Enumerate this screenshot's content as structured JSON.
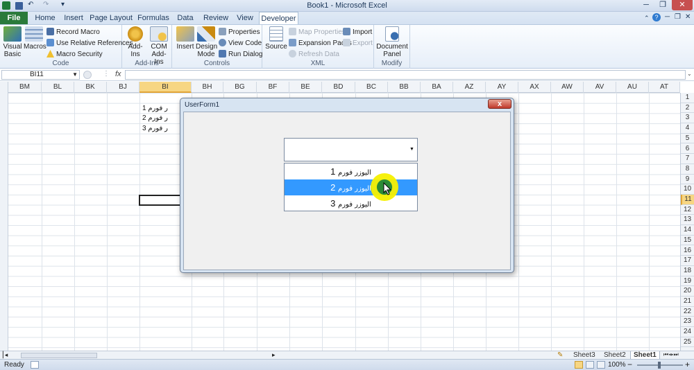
{
  "window": {
    "title": "Book1 - Microsoft Excel"
  },
  "qat": {
    "undo": "↶",
    "redo": "↷",
    "customize": "▾"
  },
  "win_controls": {
    "minimize": "─",
    "restore": "❐",
    "close": "✕"
  },
  "tabs": [
    {
      "label": "File"
    },
    {
      "label": "Home"
    },
    {
      "label": "Insert"
    },
    {
      "label": "Page Layout"
    },
    {
      "label": "Formulas"
    },
    {
      "label": "Data"
    },
    {
      "label": "Review"
    },
    {
      "label": "View"
    },
    {
      "label": "Developer"
    }
  ],
  "ribbon": {
    "code": {
      "group": "Code",
      "visual_basic": "Visual Basic",
      "macros": "Macros",
      "record_macro": "Record Macro",
      "relative": "Use Relative References",
      "security": "Macro Security"
    },
    "addins": {
      "group": "Add-Ins",
      "addins": "Add-Ins",
      "com_addins": "COM Add-Ins"
    },
    "controls": {
      "group": "Controls",
      "insert": "Insert",
      "design_mode": "Design Mode",
      "properties": "Properties",
      "view_code": "View Code",
      "run_dialog": "Run Dialog"
    },
    "xml": {
      "group": "XML",
      "source": "Source",
      "map_properties": "Map Properties",
      "expansion_packs": "Expansion Packs",
      "refresh_data": "Refresh Data",
      "import": "Import",
      "export": "Export"
    },
    "modify": {
      "group": "Modify",
      "document_panel": "Document Panel"
    }
  },
  "formula_bar": {
    "name_box": "BI11",
    "fx": "fx",
    "value": ""
  },
  "columns": [
    "BM",
    "BL",
    "BK",
    "BJ",
    "BI",
    "BH",
    "BG",
    "BF",
    "BE",
    "BD",
    "BC",
    "BB",
    "BA",
    "AZ",
    "AY",
    "AX",
    "AW",
    "AV",
    "AU",
    "AT"
  ],
  "selected_column": "BI",
  "rows": [
    "1",
    "2",
    "3",
    "4",
    "5",
    "6",
    "7",
    "8",
    "9",
    "10",
    "11",
    "12",
    "13",
    "14",
    "15",
    "16",
    "17",
    "18",
    "19",
    "20",
    "21",
    "22",
    "23",
    "24",
    "25"
  ],
  "selected_row": "11",
  "cells": [
    {
      "row": "1",
      "text": "ر فورم 1"
    },
    {
      "row": "2",
      "text": "ر فورم 2"
    },
    {
      "row": "3",
      "text": "ر فورم 3"
    }
  ],
  "userform": {
    "title": "UserForm1",
    "close_label": "x",
    "combo_value": "",
    "combo_arrow": "▼",
    "list": [
      {
        "arabic": "اليوزر فورم",
        "number": "1"
      },
      {
        "arabic": "اليوزر فورم",
        "number": "2"
      },
      {
        "arabic": "اليوزر فورم",
        "number": "3"
      }
    ],
    "selected_index": 1
  },
  "sheets": [
    {
      "label": "Sheet3"
    },
    {
      "label": "Sheet2"
    },
    {
      "label": "Sheet1"
    }
  ],
  "active_sheet": "Sheet1",
  "status": {
    "ready": "Ready",
    "zoom": "100%",
    "zoom_out": "−",
    "zoom_in": "+"
  }
}
